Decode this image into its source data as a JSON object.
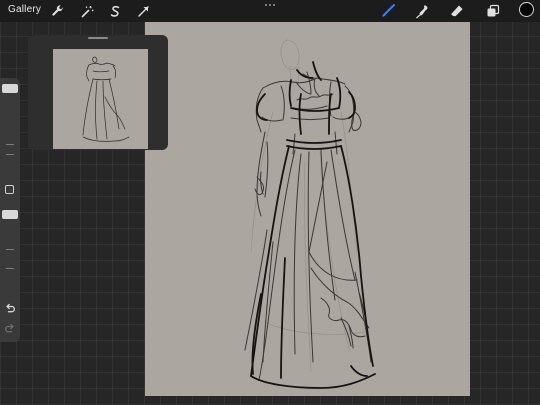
{
  "topbar": {
    "gallery_label": "Gallery",
    "left_tools": [
      "wrench-icon",
      "magic-wand-icon",
      "selection-icon",
      "transform-arrow-icon"
    ],
    "right_tools": [
      "brush-icon",
      "smudge-icon",
      "eraser-icon",
      "layers-icon"
    ],
    "active_tool": "brush",
    "colors": {
      "active_tool": "#3d7bff",
      "current_color": "#000000"
    }
  },
  "sidebar": {
    "sliders": [
      "brush-size",
      "opacity"
    ],
    "buttons": [
      "modify-square-icon",
      "undo-icon",
      "redo-icon"
    ]
  },
  "canvas": {
    "background": "#aca6a0",
    "content": "dress-sketch"
  },
  "reference_window": {
    "content": "dress-sketch-thumbnail"
  }
}
